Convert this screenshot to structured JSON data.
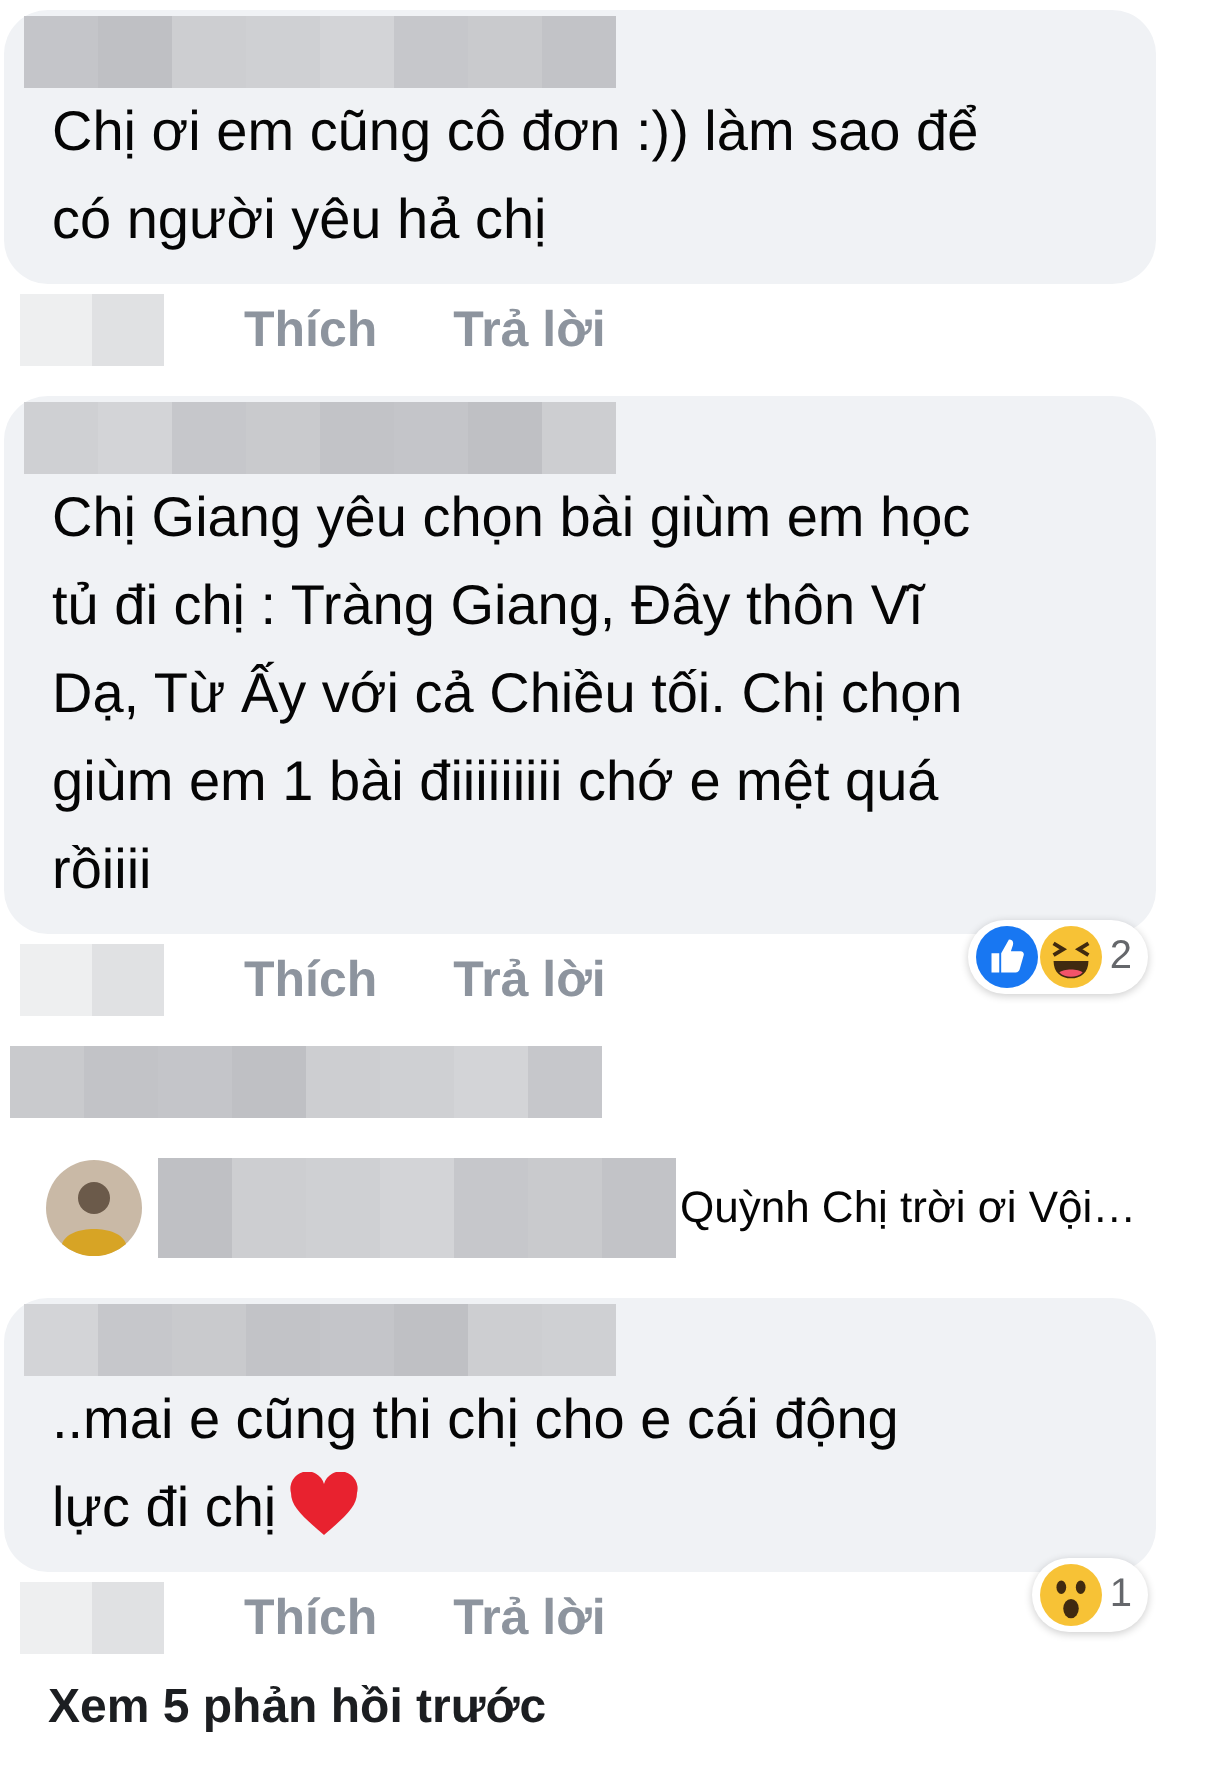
{
  "items": [
    {
      "kind": "comment",
      "lines": [
        "Chị ơi em cũng cô đơn :)) làm sao để",
        "có người yêu hả chị"
      ],
      "actions": [
        "Thích",
        "Trả lời"
      ]
    },
    {
      "kind": "comment",
      "lines": [
        "Chị Giang yêu chọn bài giùm em học",
        "tủ đi chị : Tràng Giang, Đây thôn Vĩ",
        "Dạ, Từ Ấy với cả Chiều tối. Chị chọn",
        "giùm em 1 bài điiiiiiiii chớ e mệt quá",
        "rồiiii"
      ],
      "actions": [
        "Thích",
        "Trả lời"
      ],
      "reactions": {
        "icons": [
          {
            "kind": "like"
          },
          {
            "kind": "haha"
          }
        ],
        "count": "2"
      }
    },
    {
      "kind": "hidden"
    },
    {
      "kind": "reply_preview",
      "text": "Quỳnh Chị trời ơi Vội…"
    },
    {
      "kind": "comment",
      "lines": [
        "..mai e cũng thi chị cho e cái động",
        "lực đi chị"
      ],
      "trailing_emoji": {
        "kind": "heart"
      },
      "actions": [
        "Thích",
        "Trả lời"
      ],
      "reactions": {
        "icons": [
          {
            "kind": "wow"
          }
        ],
        "count": "1"
      }
    },
    {
      "kind": "more",
      "text": "Xem 5 phản hồi trước"
    }
  ]
}
